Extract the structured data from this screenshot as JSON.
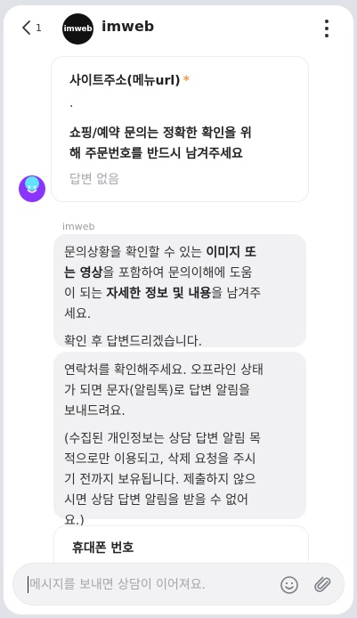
{
  "header": {
    "back_count": "1",
    "logo_text": "imweb",
    "title": "imweb"
  },
  "form": {
    "label": "사이트주소(메뉴url)",
    "required_mark": "*",
    "value": ".",
    "title_line1": "쇼핑/예약 문의는 정확한 확인을 위",
    "title_line2": "해 주문번호를 반드시 남겨주세요",
    "empty_text": "답변 없음"
  },
  "sender": "imweb",
  "bubble1": {
    "lines": [
      [
        "문의상황을 확인할 수 있는 ",
        "이미지 또"
      ],
      [
        "는 영상",
        "을 포함하여 문의이해에 도움"
      ],
      [
        "이 되는 ",
        "자세한 정보 및 내용",
        "을 남겨주"
      ],
      [
        "세요."
      ]
    ],
    "p2": "확인 후 답변드리겠습니다."
  },
  "bubble2": {
    "p1_lines": [
      "연락처를 확인해주세요. 오프라인 상태",
      "가 되면 문자(알림톡)로 답변 알림을",
      "보내드려요."
    ],
    "p2_lines": [
      "(수집된 개인정보는 상담 답변 알림 목",
      "적으로만 이용되고, 삭제 요청을 주시",
      "기 전까지 보유됩니다. 제출하지 않으",
      "시면 상담 답변 알림을 받을 수 없어",
      "요.)"
    ]
  },
  "phone": {
    "label": "휴대폰 번호"
  },
  "composer": {
    "placeholder": "메시지를 보내면 상담이 이어져요."
  },
  "colors": {
    "accent_required": "#f2994a",
    "bubble_bg": "#f1f1f3",
    "logo_bg": "#111111"
  }
}
